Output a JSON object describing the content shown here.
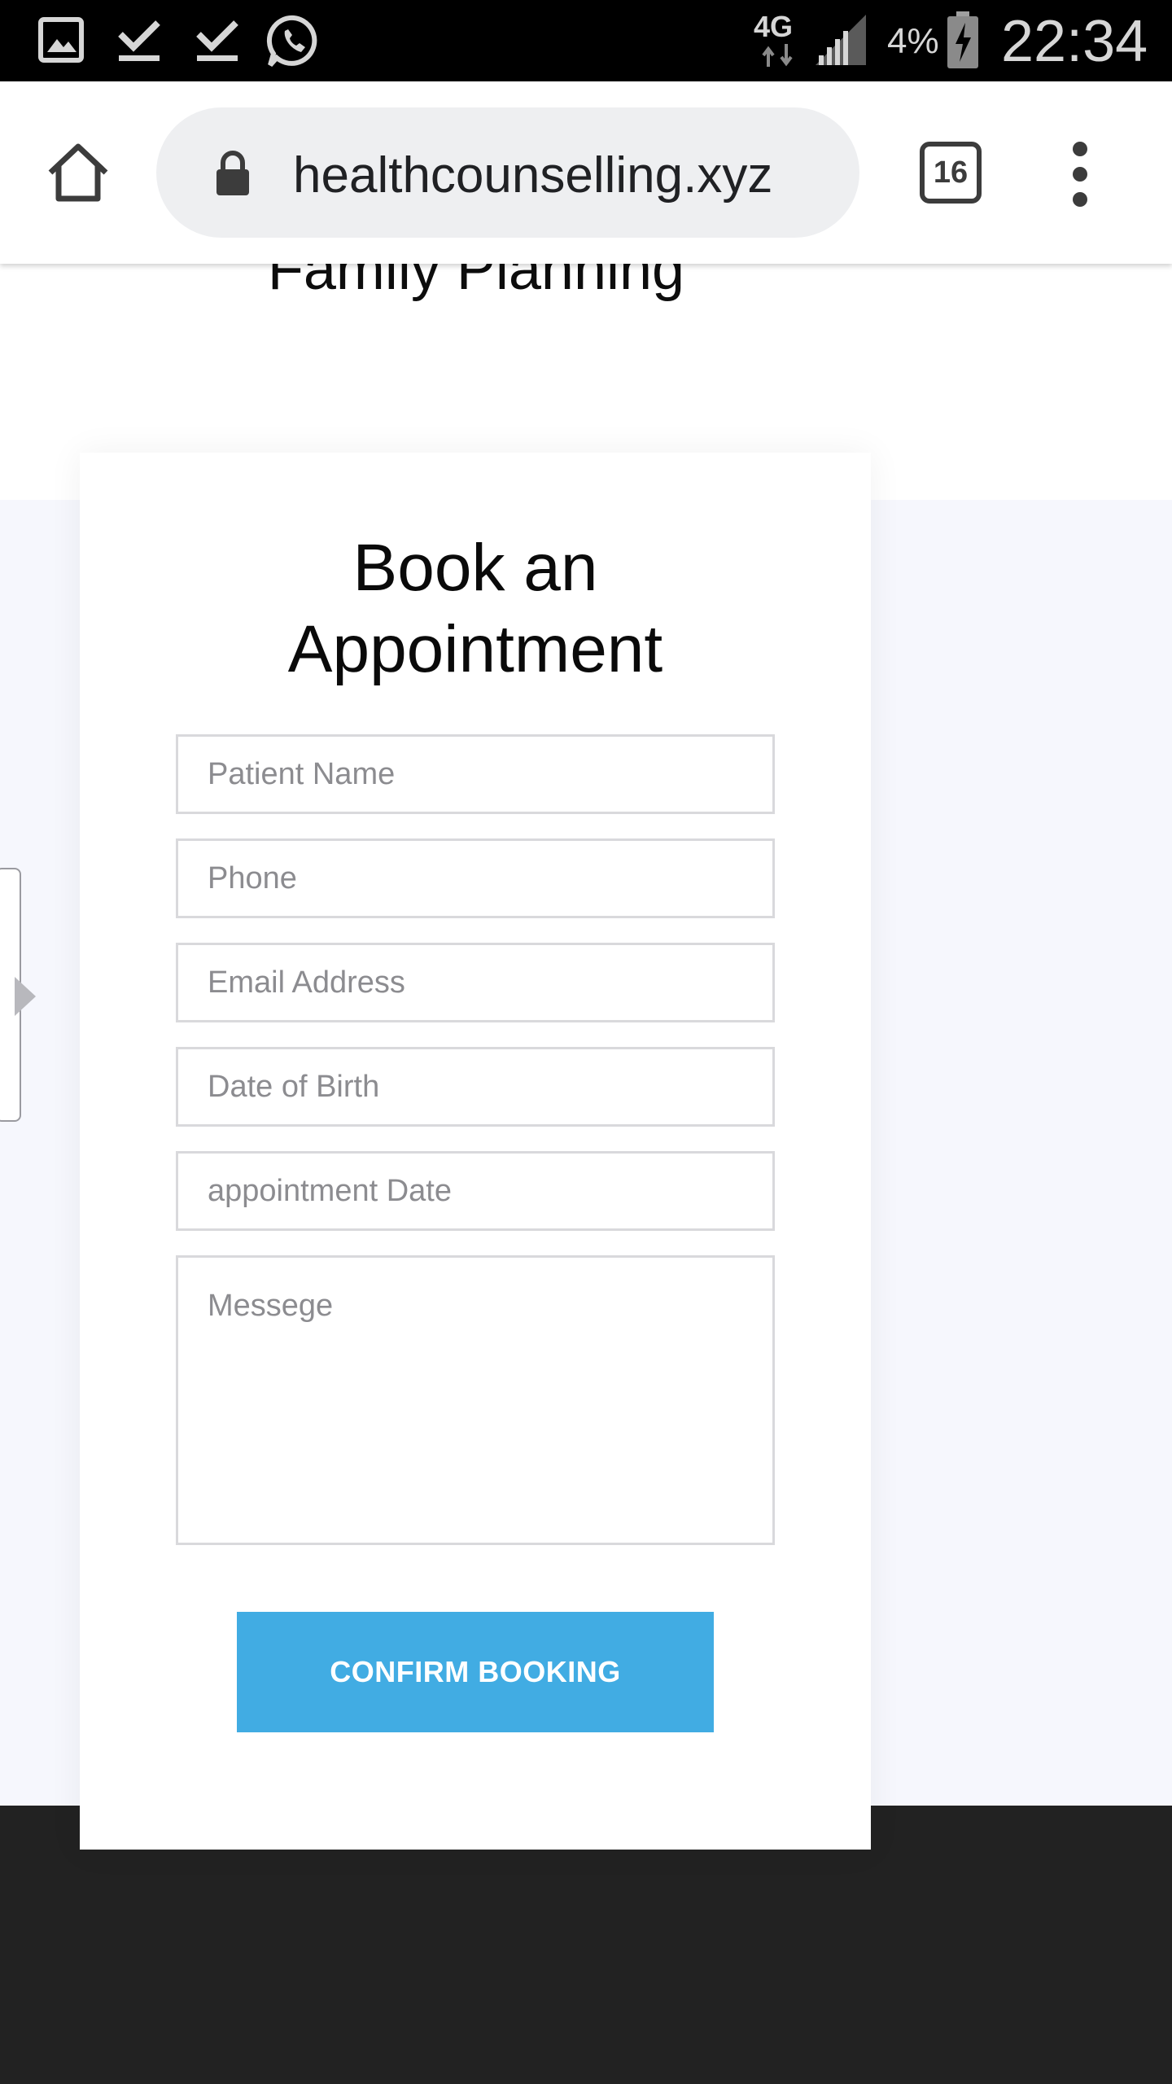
{
  "status_bar": {
    "network": "4G",
    "battery": "4%",
    "time": "22:34",
    "icons": [
      "gallery-icon",
      "download-done-icon",
      "download-done-icon",
      "whatsapp-icon",
      "network-arrows-icon",
      "signal-icon",
      "battery-charging-icon"
    ]
  },
  "browser": {
    "url": "healthcounselling.xyz",
    "tab_count": "16",
    "icons": [
      "home-icon",
      "lock-icon",
      "tabs-icon",
      "more-vert-icon"
    ]
  },
  "page": {
    "section_heading": "Family Planning",
    "colors": {
      "accent": "#41ace3",
      "page_bg": "#f6f7fd",
      "footer": "#222222"
    },
    "form": {
      "title_line1": "Book an",
      "title_line2": "Appointment",
      "fields": {
        "patient_name": "Patient Name",
        "phone": "Phone",
        "email": "Email Address",
        "dob": "Date of Birth",
        "appointment_date": "appointment Date",
        "message": "Messege"
      },
      "submit_label": "CONFIRM BOOKING"
    }
  }
}
